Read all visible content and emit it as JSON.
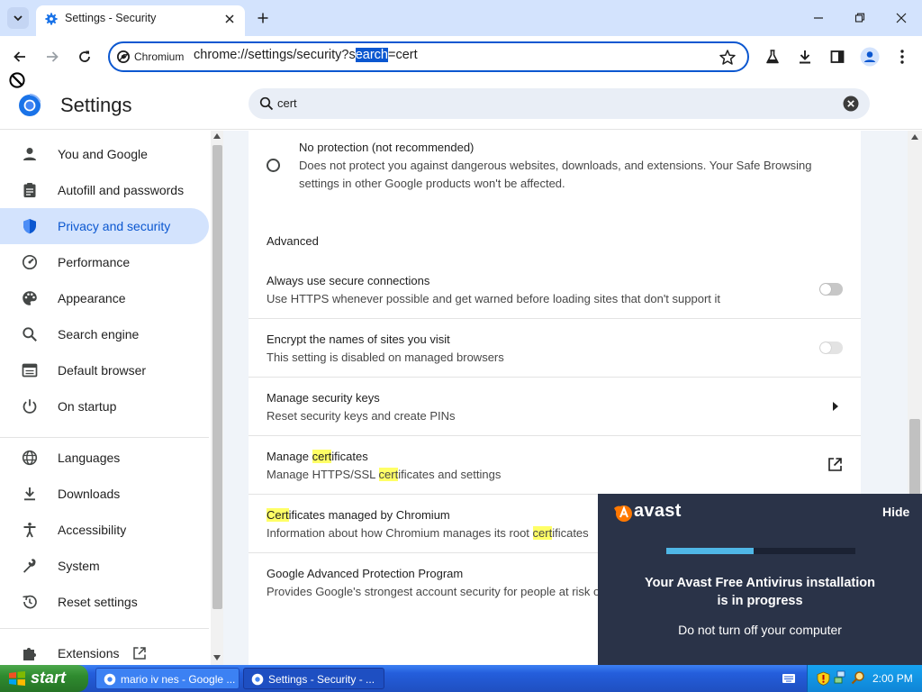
{
  "browser": {
    "tab_title": "Settings - Security",
    "omnibox_chip": "Chromium",
    "url_prefix": "chrome://settings/security?s",
    "url_selected": "earch",
    "url_suffix": "=cert"
  },
  "settings": {
    "title": "Settings",
    "search_value": "cert"
  },
  "sidebar": {
    "items": [
      {
        "label": "You and Google",
        "icon": "person-icon"
      },
      {
        "label": "Autofill and passwords",
        "icon": "clipboard-icon"
      },
      {
        "label": "Privacy and security",
        "icon": "shield-icon",
        "active": true
      },
      {
        "label": "Performance",
        "icon": "speedometer-icon"
      },
      {
        "label": "Appearance",
        "icon": "palette-icon"
      },
      {
        "label": "Search engine",
        "icon": "search-icon"
      },
      {
        "label": "Default browser",
        "icon": "browser-window-icon"
      },
      {
        "label": "On startup",
        "icon": "power-icon"
      },
      {
        "label": "Languages",
        "icon": "globe-icon"
      },
      {
        "label": "Downloads",
        "icon": "download-icon"
      },
      {
        "label": "Accessibility",
        "icon": "accessibility-icon"
      },
      {
        "label": "System",
        "icon": "wrench-icon"
      },
      {
        "label": "Reset settings",
        "icon": "history-icon"
      },
      {
        "label": "Extensions",
        "icon": "puzzle-icon"
      }
    ]
  },
  "main": {
    "no_protection": {
      "title": "No protection (not recommended)",
      "desc_line1": "Does not protect you against dangerous websites, downloads, and extensions. Your Safe Browsing",
      "desc_line2": "settings in other Google products won't be affected."
    },
    "advanced_heading": "Advanced",
    "secure_connections": {
      "title": "Always use secure connections",
      "desc": "Use HTTPS whenever possible and get warned before loading sites that don't support it"
    },
    "encrypt_names": {
      "title": "Encrypt the names of sites you visit",
      "desc": "This setting is disabled on managed browsers"
    },
    "security_keys": {
      "title": "Manage security keys",
      "desc": "Reset security keys and create PINs"
    },
    "manage_certs": {
      "title_pre": "Manage ",
      "title_hl": "cert",
      "title_post": "ificates",
      "desc_pre": "Manage HTTPS/SSL ",
      "desc_hl": "cert",
      "desc_post": "ificates and settings"
    },
    "chromium_certs": {
      "title_hl": "Cert",
      "title_post": "ificates managed by Chromium",
      "desc_pre": "Information about how Chromium manages its root ",
      "desc_hl": "cert",
      "desc_post": "ificates"
    },
    "advanced_protection": {
      "title": "Google Advanced Protection Program",
      "desc": "Provides Google's strongest account security for people at risk o"
    }
  },
  "avast": {
    "brand": "avast",
    "hide": "Hide",
    "message_line1": "Your Avast Free Antivirus installation",
    "message_line2": "is in progress",
    "message2": "Do not turn off your computer",
    "progress": 0.46,
    "accent": "#ff7800"
  },
  "taskbar": {
    "start": "start",
    "tasks": [
      {
        "label": "mario iv nes - Google ..."
      },
      {
        "label": "Settings - Security - ..."
      }
    ],
    "clock": "2:00 PM"
  },
  "colors": {
    "accent": "#0b57d0",
    "tabstrip": "#d3e3fd",
    "highlight": "#ffff66"
  }
}
